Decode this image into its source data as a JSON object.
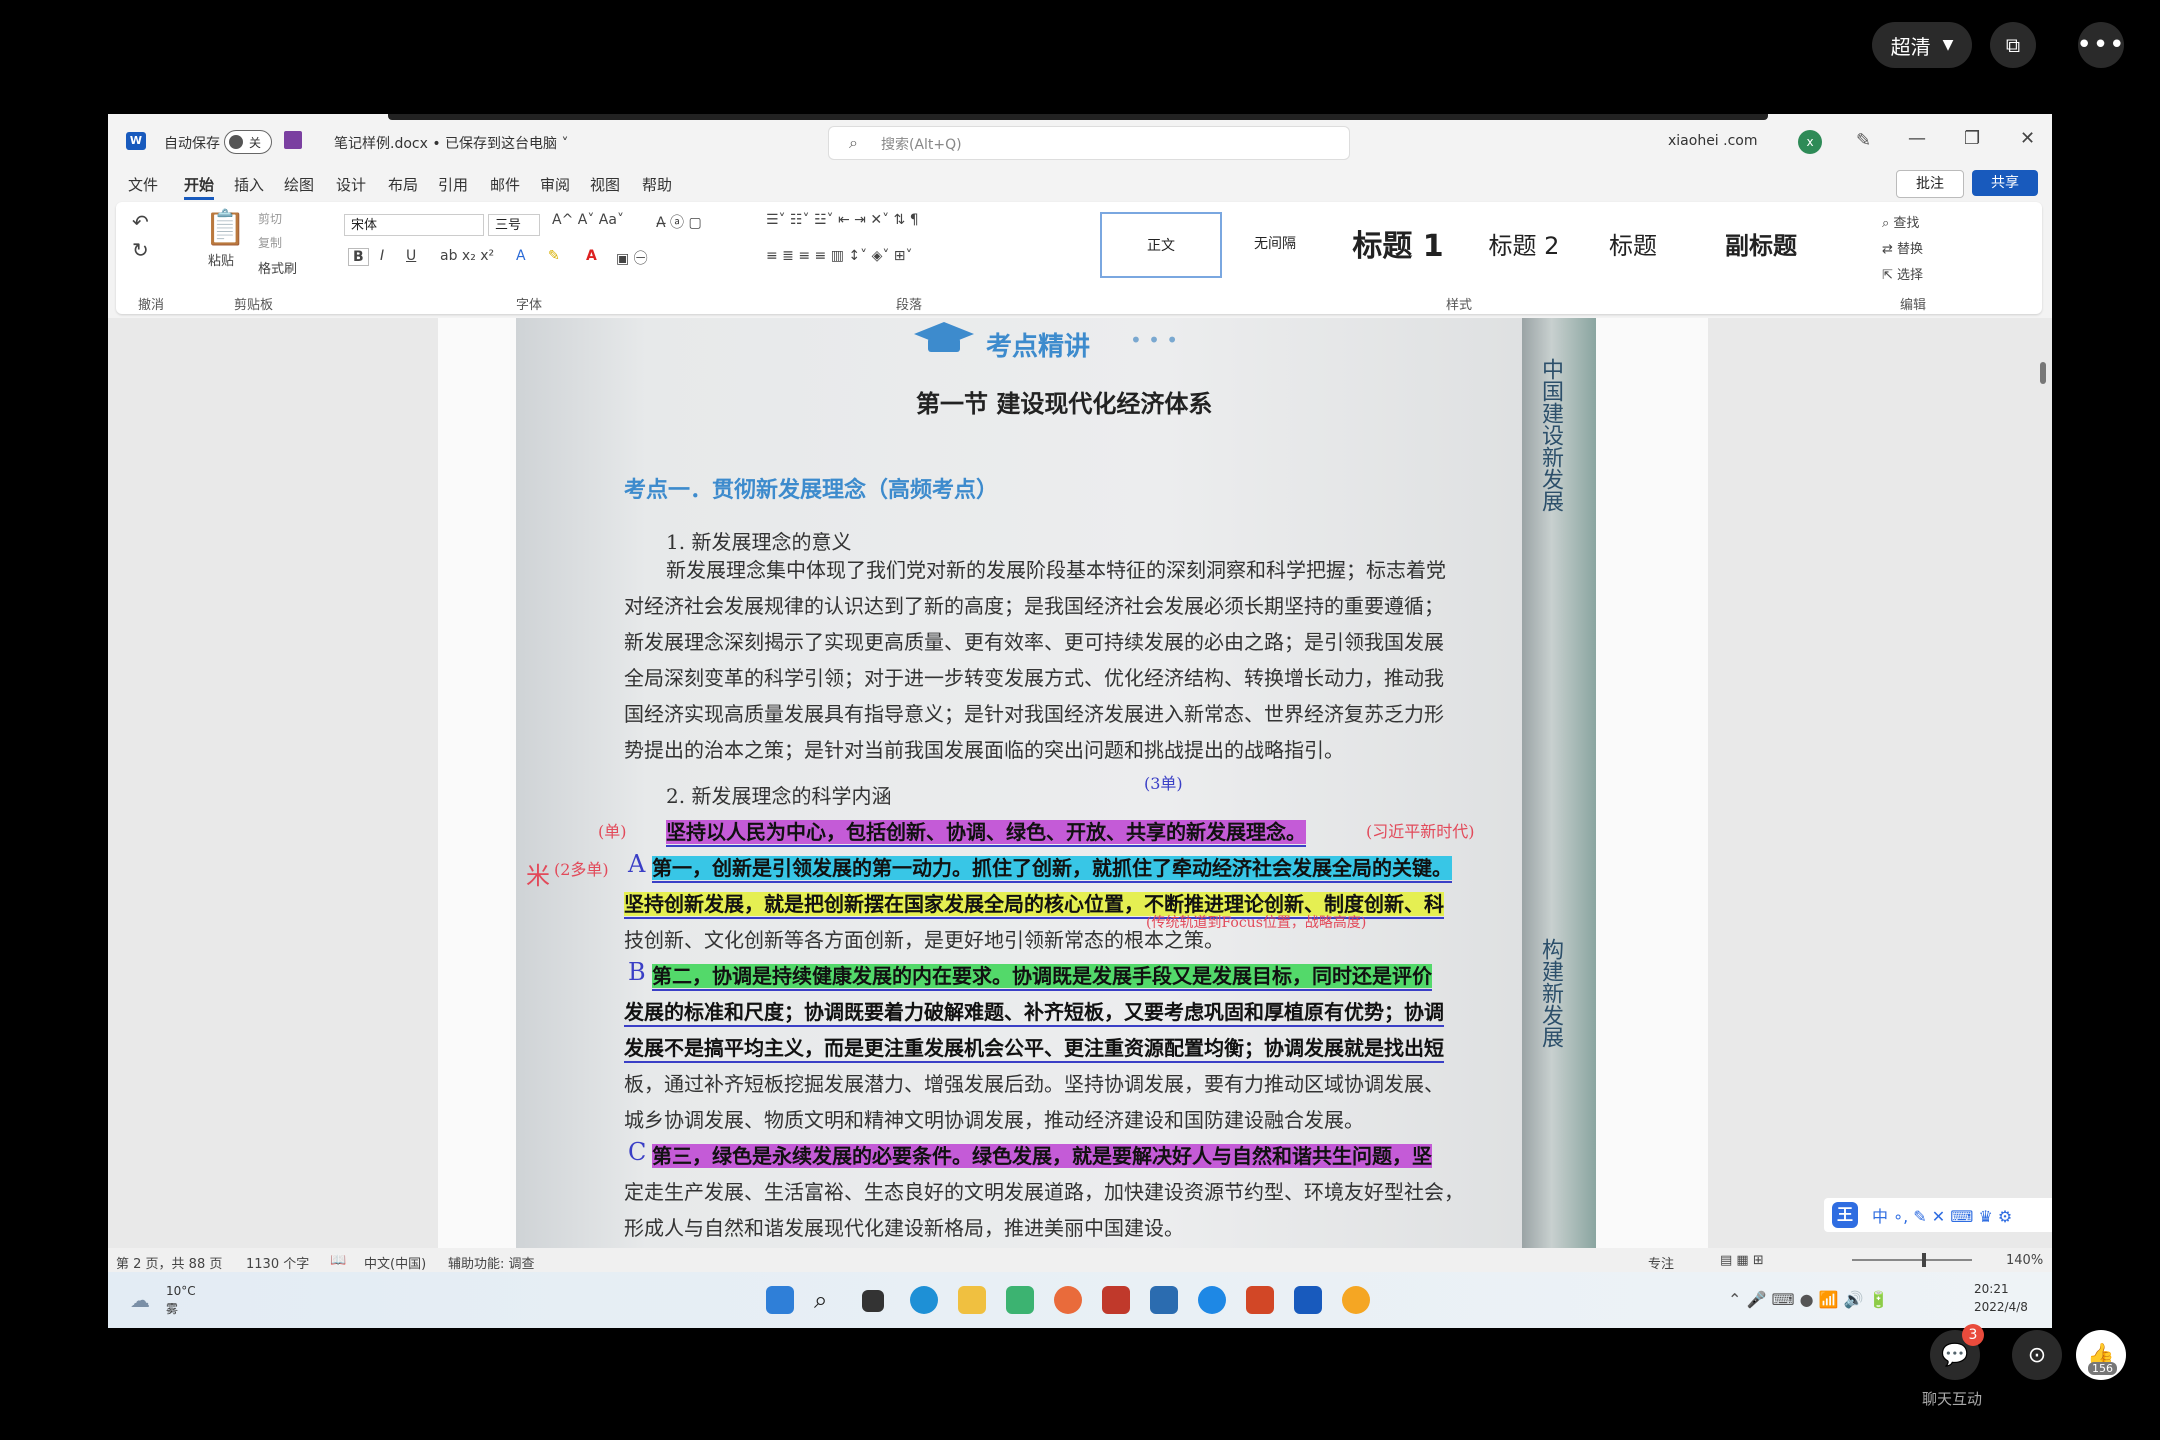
{
  "overlay": {
    "quality_label": "超清",
    "chat_badge": "3",
    "chat_label": "聊天互动",
    "like_count": "156"
  },
  "word": {
    "autosave_label": "自动保存",
    "autosave_state": "关",
    "doc_title": "笔记样例.docx • 已保存到这台电脑 ˅",
    "search_placeholder": "搜索(Alt+Q)",
    "account": "xiaohei .com",
    "avatar_initial": "x",
    "tabs": [
      "文件",
      "开始",
      "插入",
      "绘图",
      "设计",
      "布局",
      "引用",
      "邮件",
      "审阅",
      "视图",
      "帮助"
    ],
    "comment_btn": "批注",
    "share_btn": "共享",
    "ribbon": {
      "undo_label": "撤消",
      "paste_label": "粘贴",
      "cut_label": "剪切",
      "copy_label": "复制",
      "format_painter": "格式刷",
      "clipboard_label": "剪贴板",
      "font_name": "宋体",
      "font_size": "三号",
      "font_group": "字体",
      "paragraph_group": "段落",
      "styles_group": "样式",
      "editing_group": "编辑",
      "styles": [
        "正文",
        "无间隔",
        "标题 1",
        "标题 2",
        "标题",
        "副标题"
      ],
      "find": "查找",
      "replace": "替换",
      "select": "选择"
    },
    "status": {
      "page": "第 2 页，共 88 页",
      "words": "1130 个字",
      "language": "中文(中国)",
      "accessibility": "辅助功能: 调查",
      "focus": "专注",
      "zoom": "140%"
    }
  },
  "document": {
    "exam_title": "考点精讲",
    "section_title": "第一节  建设现代化经济体系",
    "topic_title": "考点一．贯彻新发展理念（高频考点）",
    "p1_heading": "1. 新发展理念的意义",
    "p1_lines": [
      "新发展理念集中体现了我们党对新的发展阶段基本特征的深刻洞察和科学把握；标志着党",
      "对经济社会发展规律的认识达到了新的高度；是我国经济社会发展必须长期坚持的重要遵循；",
      "新发展理念深刻揭示了实现更高质量、更有效率、更可持续发展的必由之路；是引领我国发展",
      "全局深刻变革的科学引领；对于进一步转变发展方式、优化经济结构、转换增长动力，推动我",
      "国经济实现高质量发展具有指导意义；是针对我国经济发展进入新常态、世界经济复苏乏力形",
      "势提出的治本之策；是针对当前我国发展面临的突出问题和挑战提出的战略指引。"
    ],
    "p2_heading": "2. 新发展理念的科学内涵",
    "p2_lines": {
      "l1": "坚持以人民为中心，包括创新、协调、绿色、开放、共享的新发展理念。",
      "l2": "第一，创新是引领发展的第一动力。抓住了创新，就抓住了牵动经济社会发展全局的关键。",
      "l3": "坚持创新发展，就是把创新摆在国家发展全局的核心位置，不断推进理论创新、制度创新、科",
      "l4": "技创新、文化创新等各方面创新，是更好地引领新常态的根本之策。",
      "l5": "第二，协调是持续健康发展的内在要求。协调既是发展手段又是发展目标，同时还是评价",
      "l6": "发展的标准和尺度；协调既要着力破解难题、补齐短板，又要考虑巩固和厚植原有优势；协调",
      "l7": "发展不是搞平均主义，而是更注重发展机会公平、更注重资源配置均衡；协调发展就是找出短",
      "l8": "板，通过补齐短板挖掘发展潜力、增强发展后劲。坚持协调发展，要有力推动区域协调发展、",
      "l9": "城乡协调发展、物质文明和精神文明协调发展，推动经济建设和国防建设融合发展。",
      "l10": "第三，绿色是永续发展的必要条件。绿色发展，就是要解决好人与自然和谐共生问题，坚",
      "l11": "定走生产发展、生活富裕、生态良好的文明发展道路，加快建设资源节约型、环境友好型社会，",
      "l12": "形成人与自然和谐发展现代化建设新格局，推进美丽中国建设。"
    },
    "notes": {
      "n1": "(3单)",
      "n2": "(单)",
      "n3": "(2多单)",
      "n4": "(习近平新时代)",
      "n5": "(传统轨道到Focus位置，战略高度)",
      "star": "米",
      "a": "A",
      "b": "B",
      "c": "C"
    },
    "edge_text": [
      "中国建设新发展",
      "构建新发展"
    ]
  },
  "taskbar": {
    "temp": "10°C",
    "weather": "雾",
    "time": "20:21",
    "date": "2022/4/8"
  }
}
